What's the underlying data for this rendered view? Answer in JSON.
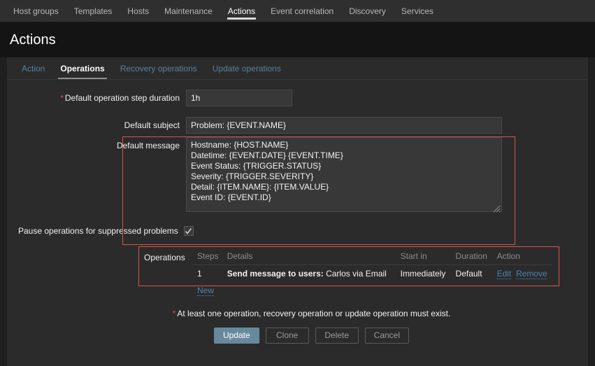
{
  "topnav": {
    "items": [
      {
        "label": "Host groups",
        "active": false
      },
      {
        "label": "Templates",
        "active": false
      },
      {
        "label": "Hosts",
        "active": false
      },
      {
        "label": "Maintenance",
        "active": false
      },
      {
        "label": "Actions",
        "active": true
      },
      {
        "label": "Event correlation",
        "active": false
      },
      {
        "label": "Discovery",
        "active": false
      },
      {
        "label": "Services",
        "active": false
      }
    ]
  },
  "header": {
    "title": "Actions"
  },
  "tabs": [
    {
      "label": "Action",
      "active": false
    },
    {
      "label": "Operations",
      "active": true
    },
    {
      "label": "Recovery operations",
      "active": false
    },
    {
      "label": "Update operations",
      "active": false
    }
  ],
  "form": {
    "step_duration": {
      "label": "Default operation step duration",
      "required_marker": "*",
      "value": "1h"
    },
    "default_subject": {
      "label": "Default subject",
      "value": "Problem: {EVENT.NAME}"
    },
    "default_message": {
      "label": "Default message",
      "value": "Hostname: {HOST.NAME}\nDatetime: {EVENT.DATE} {EVENT.TIME}\nEvent Status: {TRIGGER.STATUS}\nSeverity: {TRIGGER.SEVERITY}\nDetail: {ITEM.NAME}: {ITEM.VALUE}\nEvent ID: {EVENT.ID}"
    },
    "pause_suppressed": {
      "label": "Pause operations for suppressed problems",
      "checked": true
    }
  },
  "operations": {
    "label": "Operations",
    "columns": [
      "Steps",
      "Details",
      "Start in",
      "Duration",
      "Action"
    ],
    "rows": [
      {
        "steps": "1",
        "details_strong": "Send message to users:",
        "details_rest": " Carlos via Email",
        "start_in": "Immediately",
        "duration": "Default",
        "edit_label": "Edit",
        "remove_label": "Remove"
      }
    ],
    "new_label": "New"
  },
  "footer": {
    "required_marker": "*",
    "note": "At least one operation, recovery operation or update operation must exist.",
    "buttons": [
      {
        "label": "Update",
        "primary": true
      },
      {
        "label": "Clone",
        "primary": false
      },
      {
        "label": "Delete",
        "primary": false
      },
      {
        "label": "Cancel",
        "primary": false
      }
    ]
  },
  "colors": {
    "accent_link": "#4c84b4",
    "error_border": "#d9534f",
    "required": "#d45252",
    "primary_button": "#67899e"
  }
}
